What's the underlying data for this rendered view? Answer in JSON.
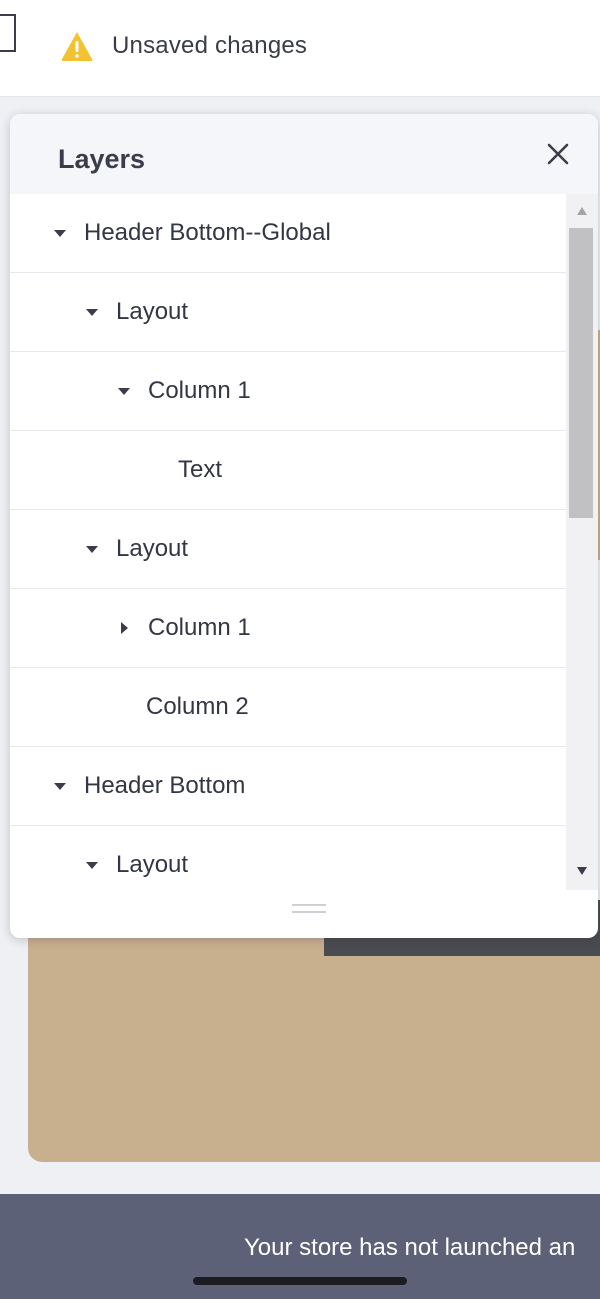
{
  "topbar": {
    "status_icon": "warning-icon",
    "status_text": "Unsaved changes",
    "warning_color": "#f2c230"
  },
  "layers_panel": {
    "title": "Layers",
    "close_icon": "close-icon",
    "items": [
      {
        "label": "Header Bottom--Global",
        "level": 0,
        "toggle": "expanded"
      },
      {
        "label": "Layout",
        "level": 1,
        "toggle": "expanded"
      },
      {
        "label": "Column 1",
        "level": 2,
        "toggle": "expanded"
      },
      {
        "label": "Text",
        "level": 3,
        "toggle": "none"
      },
      {
        "label": "Layout",
        "level": 1,
        "toggle": "expanded"
      },
      {
        "label": "Column 1",
        "level": 2,
        "toggle": "collapsed"
      },
      {
        "label": "Column 2",
        "level": 2,
        "toggle": "none"
      },
      {
        "label": "Header Bottom",
        "level": 0,
        "toggle": "expanded"
      },
      {
        "label": "Layout",
        "level": 1,
        "toggle": "expanded"
      }
    ]
  },
  "banner": {
    "text": "Your store has not launched an"
  },
  "colors": {
    "panel_header_bg": "#f5f6fa",
    "banner_bg": "#5d6178",
    "canvas_tan": "#c8af8e"
  }
}
